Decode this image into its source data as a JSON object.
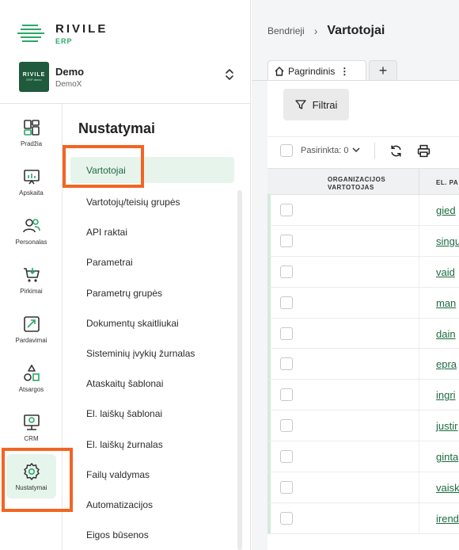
{
  "brand": {
    "title": "RIVILE",
    "subtitle": "ERP"
  },
  "company": {
    "logo_text": "RIVILE",
    "logo_sub": "ERP demo",
    "name": "Demo",
    "sub": "DemoX"
  },
  "rail": [
    {
      "label": "Pradžia",
      "icon": "dashboard-icon"
    },
    {
      "label": "Apskaita",
      "icon": "chart-board-icon"
    },
    {
      "label": "Personalas",
      "icon": "people-icon"
    },
    {
      "label": "Pirkimai",
      "icon": "cart-icon"
    },
    {
      "label": "Pardavimai",
      "icon": "sales-icon"
    },
    {
      "label": "Atsargos",
      "icon": "shapes-icon"
    },
    {
      "label": "CRM",
      "icon": "crm-icon"
    },
    {
      "label": "Nustatymai",
      "icon": "gear-icon",
      "active": true
    }
  ],
  "menu": {
    "title": "Nustatymai",
    "items": [
      "Vartotojai",
      "Vartotojų/teisių grupės",
      "API raktai",
      "Parametrai",
      "Parametrų grupės",
      "Dokumentų skaitliukai",
      "Sisteminių įvykių žurnalas",
      "Ataskaitų šablonai",
      "El. laiškų šablonai",
      "El. laiškų žurnalas",
      "Failų valdymas",
      "Automatizacijos",
      "Eigos būsenos"
    ],
    "active_index": 0
  },
  "breadcrumb": {
    "parent": "Bendrieji",
    "separator": "›",
    "current": "Vartotojai"
  },
  "tabs": {
    "main": "Pagrindinis",
    "menu_glyph": "⋮",
    "add": "+"
  },
  "toolbar": {
    "filter_label": "Filtrai",
    "selected_label": "Pasirinkta: 0"
  },
  "table": {
    "columns": [
      "ORGANIZACIJOS VARTOTOJAS",
      "EL. PA"
    ],
    "rows": [
      {
        "email": "gied"
      },
      {
        "email": "singu"
      },
      {
        "email": "vaid"
      },
      {
        "email": "man"
      },
      {
        "email": "dain"
      },
      {
        "email": "epra"
      },
      {
        "email": "ingri"
      },
      {
        "email": "justir"
      },
      {
        "email": "ginta"
      },
      {
        "email": "vaisk"
      },
      {
        "email": "irend"
      }
    ]
  },
  "colors": {
    "accent": "#2aa867",
    "highlight": "#f26522",
    "link": "#1c6b3f"
  }
}
